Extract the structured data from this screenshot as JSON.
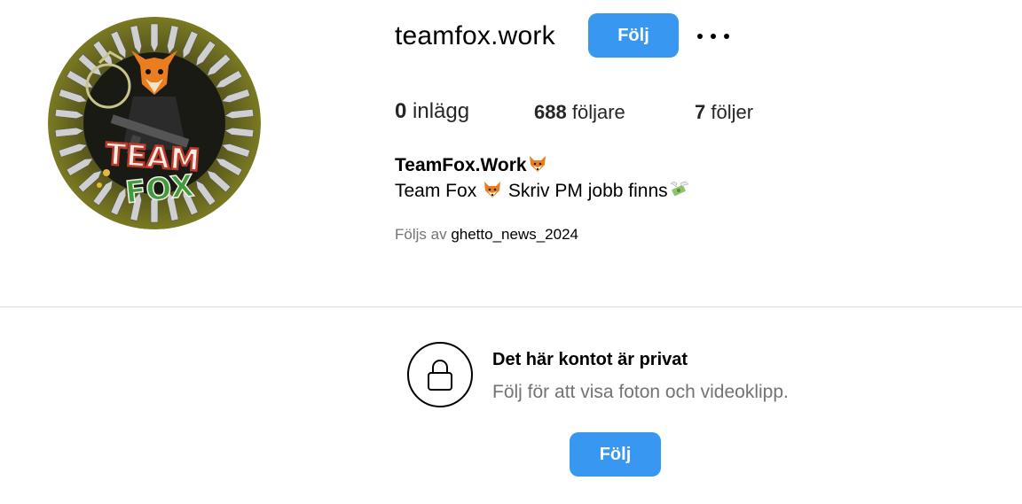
{
  "profile": {
    "username": "teamfox.work",
    "follow_label": "Följ",
    "more_icon": "more-horizontal-icon",
    "avatar_icon": "team-fox-logo",
    "avatar_logo_text_1": "TEAM",
    "avatar_logo_text_2": "FOX"
  },
  "stats": {
    "posts_count": "0",
    "posts_label": "inlägg",
    "followers_count": "688",
    "followers_label": "följare",
    "following_count": "7",
    "following_label": "följer"
  },
  "bio": {
    "full_name": "TeamFox.Work",
    "text_part1": "Team Fox",
    "text_part2": "Skriv PM jobb finns",
    "fox_emoji_icon": "fox-emoji",
    "money_emoji_icon": "money-with-wings-emoji"
  },
  "followed_by": {
    "prefix": "Följs av",
    "user": "ghetto_news_2024"
  },
  "private": {
    "icon": "lock-icon",
    "title": "Det här kontot är privat",
    "subtitle": "Följ för att visa foton och videoklipp.",
    "follow_label": "Följ"
  },
  "colors": {
    "accent": "#3897f0",
    "muted_text": "#737373",
    "divider": "#dbdbdb"
  }
}
